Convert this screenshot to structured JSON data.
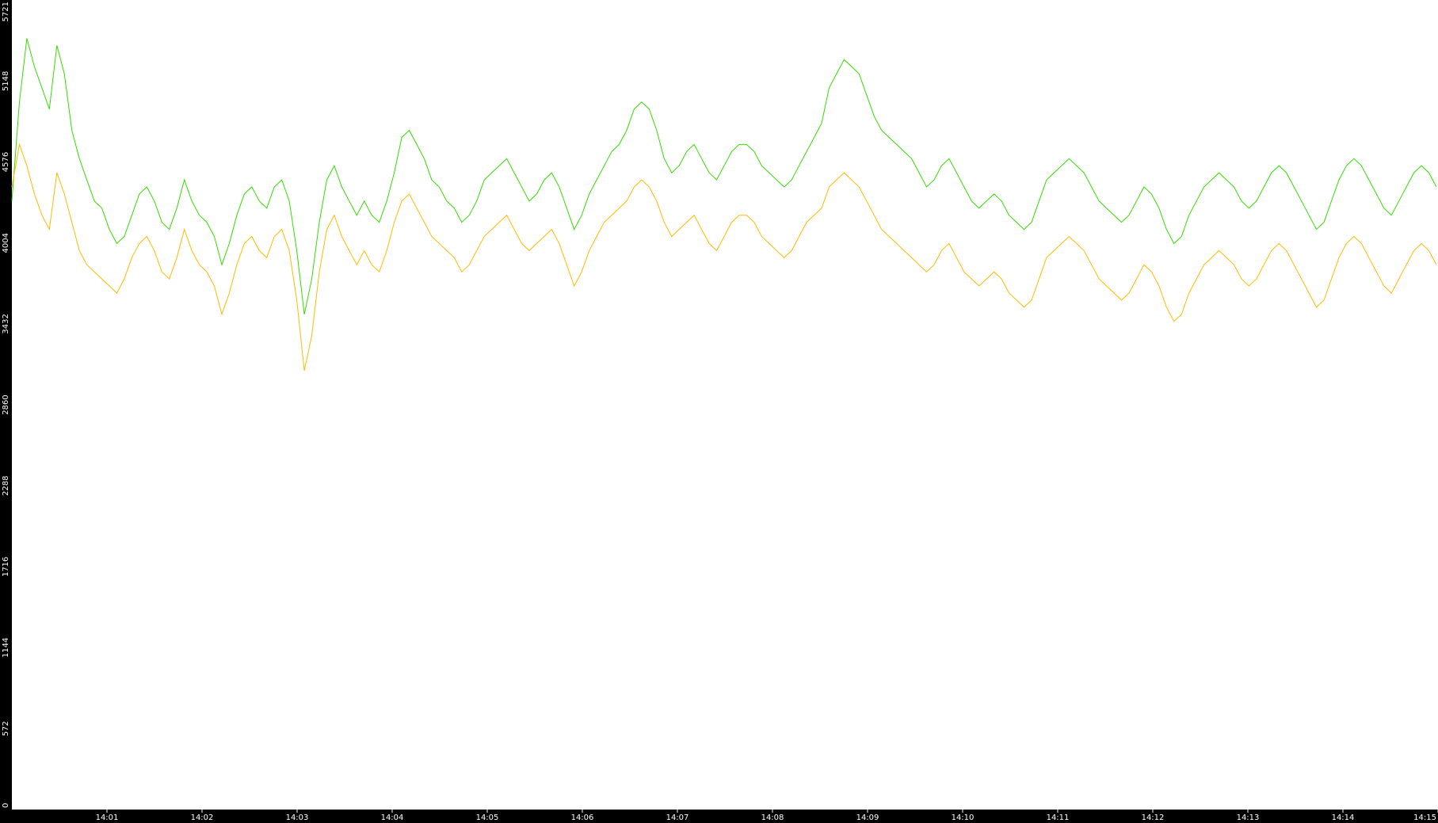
{
  "chart_data": {
    "type": "line",
    "title": "",
    "xlabel": "",
    "ylabel": "",
    "ylim": [
      0,
      5721
    ],
    "y_ticks": [
      "0",
      "572",
      "1144",
      "1716",
      "2288",
      "2860",
      "3432",
      "4004",
      "4576",
      "5148",
      "5721"
    ],
    "x_ticks": [
      "14:01",
      "14:02",
      "14:03",
      "14:04",
      "14:05",
      "14:06",
      "14:07",
      "14:08",
      "14:09",
      "14:10",
      "14:11",
      "14:12",
      "14:13",
      "14:14",
      "14:15"
    ],
    "x_range_minutes": [
      0,
      15
    ],
    "grid": false,
    "legend": "none",
    "background_color": "#ffffff",
    "axis_panel_color": "#000000",
    "series": [
      {
        "color": "#33dd00",
        "values": [
          4300,
          5000,
          5450,
          5250,
          5100,
          4950,
          5400,
          5200,
          4800,
          4600,
          4450,
          4300,
          4250,
          4100,
          4000,
          4050,
          4200,
          4350,
          4400,
          4300,
          4150,
          4100,
          4250,
          4450,
          4300,
          4200,
          4150,
          4050,
          3850,
          4000,
          4200,
          4350,
          4400,
          4300,
          4250,
          4400,
          4450,
          4300,
          3950,
          3500,
          3750,
          4150,
          4450,
          4550,
          4400,
          4300,
          4200,
          4300,
          4200,
          4150,
          4300,
          4500,
          4750,
          4800,
          4700,
          4600,
          4450,
          4400,
          4300,
          4250,
          4150,
          4200,
          4300,
          4450,
          4500,
          4550,
          4600,
          4500,
          4400,
          4300,
          4350,
          4450,
          4500,
          4400,
          4250,
          4100,
          4200,
          4350,
          4450,
          4550,
          4650,
          4700,
          4800,
          4950,
          5000,
          4950,
          4800,
          4600,
          4500,
          4550,
          4650,
          4700,
          4600,
          4500,
          4450,
          4550,
          4650,
          4700,
          4700,
          4650,
          4550,
          4500,
          4450,
          4400,
          4450,
          4550,
          4650,
          4750,
          4850,
          5100,
          5200,
          5300,
          5250,
          5200,
          5050,
          4900,
          4800,
          4750,
          4700,
          4650,
          4600,
          4500,
          4400,
          4450,
          4550,
          4600,
          4500,
          4400,
          4300,
          4250,
          4300,
          4350,
          4300,
          4200,
          4150,
          4100,
          4150,
          4300,
          4450,
          4500,
          4550,
          4600,
          4550,
          4500,
          4400,
          4300,
          4250,
          4200,
          4150,
          4200,
          4300,
          4400,
          4350,
          4250,
          4100,
          4000,
          4050,
          4200,
          4300,
          4400,
          4450,
          4500,
          4450,
          4400,
          4300,
          4250,
          4300,
          4400,
          4500,
          4550,
          4500,
          4400,
          4300,
          4200,
          4100,
          4150,
          4300,
          4450,
          4550,
          4600,
          4550,
          4450,
          4350,
          4250,
          4200,
          4300,
          4400,
          4500,
          4550,
          4500,
          4400
        ]
      },
      {
        "color": "#ffbb00",
        "values": [
          4400,
          4700,
          4550,
          4350,
          4200,
          4100,
          4500,
          4350,
          4150,
          3950,
          3850,
          3800,
          3750,
          3700,
          3650,
          3750,
          3900,
          4000,
          4050,
          3950,
          3800,
          3750,
          3900,
          4100,
          3950,
          3850,
          3800,
          3700,
          3500,
          3650,
          3850,
          4000,
          4050,
          3950,
          3900,
          4050,
          4100,
          3950,
          3600,
          3100,
          3350,
          3800,
          4100,
          4200,
          4050,
          3950,
          3850,
          3950,
          3850,
          3800,
          3950,
          4150,
          4300,
          4350,
          4250,
          4150,
          4050,
          4000,
          3950,
          3900,
          3800,
          3850,
          3950,
          4050,
          4100,
          4150,
          4200,
          4100,
          4000,
          3950,
          4000,
          4050,
          4100,
          4000,
          3850,
          3700,
          3800,
          3950,
          4050,
          4150,
          4200,
          4250,
          4300,
          4400,
          4450,
          4400,
          4300,
          4150,
          4050,
          4100,
          4150,
          4200,
          4100,
          4000,
          3950,
          4050,
          4150,
          4200,
          4200,
          4150,
          4050,
          4000,
          3950,
          3900,
          3950,
          4050,
          4150,
          4200,
          4250,
          4400,
          4450,
          4500,
          4450,
          4400,
          4300,
          4200,
          4100,
          4050,
          4000,
          3950,
          3900,
          3850,
          3800,
          3850,
          3950,
          4000,
          3900,
          3800,
          3750,
          3700,
          3750,
          3800,
          3750,
          3650,
          3600,
          3550,
          3600,
          3750,
          3900,
          3950,
          4000,
          4050,
          4000,
          3950,
          3850,
          3750,
          3700,
          3650,
          3600,
          3650,
          3750,
          3850,
          3800,
          3700,
          3550,
          3450,
          3500,
          3650,
          3750,
          3850,
          3900,
          3950,
          3900,
          3850,
          3750,
          3700,
          3750,
          3850,
          3950,
          4000,
          3950,
          3850,
          3750,
          3650,
          3550,
          3600,
          3750,
          3900,
          4000,
          4050,
          4000,
          3900,
          3800,
          3700,
          3650,
          3750,
          3850,
          3950,
          4000,
          3950,
          3850
        ]
      }
    ]
  }
}
